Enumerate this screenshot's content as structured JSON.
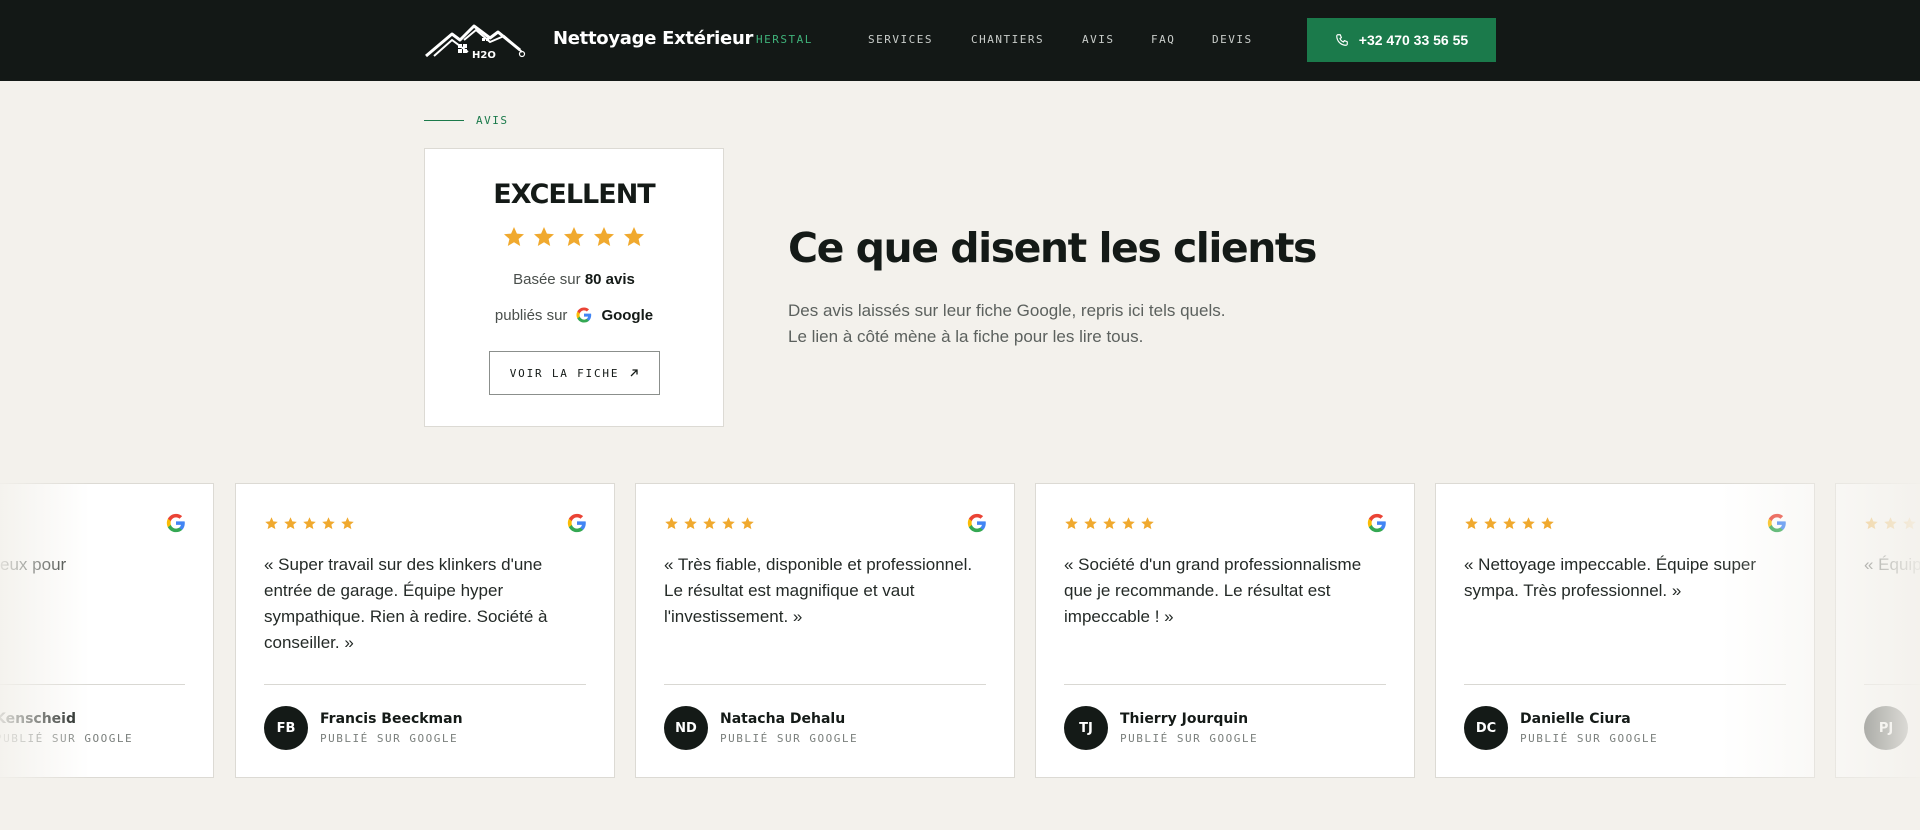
{
  "header": {
    "brand": "Nettoyage Extérieur",
    "city": "HERSTAL",
    "logo_text": "H2O",
    "nav": [
      {
        "label": "SERVICES"
      },
      {
        "label": "CHANTIERS"
      },
      {
        "label": "AVIS"
      },
      {
        "label": "FAQ"
      },
      {
        "label": "DEVIS"
      }
    ],
    "phone": "+32 470 33 56 55"
  },
  "section": {
    "label": "AVIS",
    "heading": "Ce que disent les clients",
    "subtitle_line1": "Des avis laissés sur leur fiche Google, repris ici tels quels.",
    "subtitle_line2": "Le lien à côté mène à la fiche pour les lire tous."
  },
  "rating": {
    "title": "EXCELLENT",
    "stars": 5,
    "based_prefix": "Basée sur",
    "based_count": "80 avis",
    "published_prefix": "publiés sur",
    "published_platform": "Google",
    "button": "VOIR LA FICHE"
  },
  "reviews": [
    {
      "stars": 5,
      "quote": "« Rapide et minutieux pour",
      "author": "Kenscheid",
      "initials": "",
      "published": "PUBLIÉ SUR GOOGLE"
    },
    {
      "stars": 5,
      "quote": "« Super travail sur des klinkers d'une entrée de garage. Équipe hyper sympathique. Rien à redire. Société à conseiller. »",
      "author": "Francis Beeckman",
      "initials": "FB",
      "published": "PUBLIÉ SUR GOOGLE"
    },
    {
      "stars": 5,
      "quote": "« Très fiable, disponible et professionnel. Le résultat est magnifique et vaut l'investissement. »",
      "author": "Natacha Dehalu",
      "initials": "ND",
      "published": "PUBLIÉ SUR GOOGLE"
    },
    {
      "stars": 5,
      "quote": "« Société d'un grand professionnalisme que je recommande. Le résultat est impeccable ! »",
      "author": "Thierry Jourquin",
      "initials": "TJ",
      "published": "PUBLIÉ SUR GOOGLE"
    },
    {
      "stars": 5,
      "quote": "« Nettoyage impeccable. Équipe super sympa. Très professionnel. »",
      "author": "Danielle Ciura",
      "initials": "DC",
      "published": "PUBLIÉ SUR GOOGLE"
    },
    {
      "stars": 5,
      "quote": "« Équipe et travail",
      "author": "",
      "initials": "PJ",
      "published": ""
    }
  ],
  "colors": {
    "header_bg": "#131816",
    "accent_green": "#1b7a4b",
    "star_gold": "#f0a92e",
    "page_bg": "#f3f1ec"
  }
}
